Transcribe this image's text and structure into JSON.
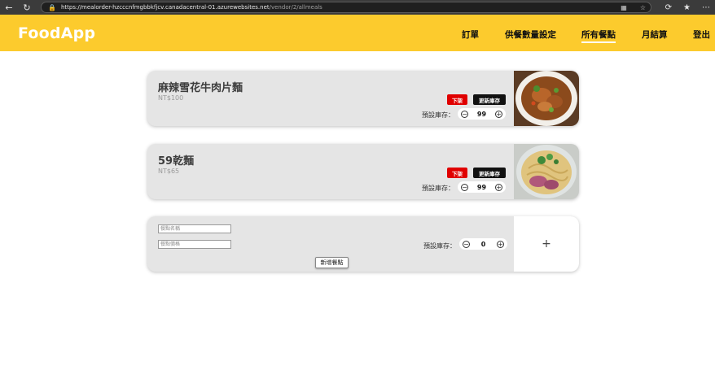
{
  "browser": {
    "url_host": "https://mealorder-hzcccnfmgbbkfjcv.canadacentral-01.azurewebsites.net",
    "url_path": "/vendor/2/allmeals"
  },
  "app": {
    "logo": "FoodApp",
    "nav": [
      "訂單",
      "供餐數量設定",
      "所有餐點",
      "月結算",
      "登出"
    ],
    "active_nav": "所有餐點"
  },
  "meals": [
    {
      "name": "麻辣雪花牛肉片麵",
      "price": "NT$100",
      "remove_label": "下架",
      "update_label": "更新庫存",
      "stock_label": "預設庫存：",
      "stock": "99",
      "image": "beef-noodle-photo"
    },
    {
      "name": "59乾麵",
      "price": "NT$65",
      "remove_label": "下架",
      "update_label": "更新庫存",
      "stock_label": "預設庫存：",
      "stock": "99",
      "image": "dry-noodle-photo"
    }
  ],
  "new_meal": {
    "name_placeholder": "餐點名稱",
    "price_placeholder": "餐點價格",
    "stock_label": "預設庫存：",
    "stock": "0",
    "add_label": "新增餐點",
    "add_image_symbol": "+"
  },
  "colors": {
    "header": "#fccb2d",
    "remove": "#e00000",
    "update": "#111111",
    "card": "#e5e5e5"
  }
}
